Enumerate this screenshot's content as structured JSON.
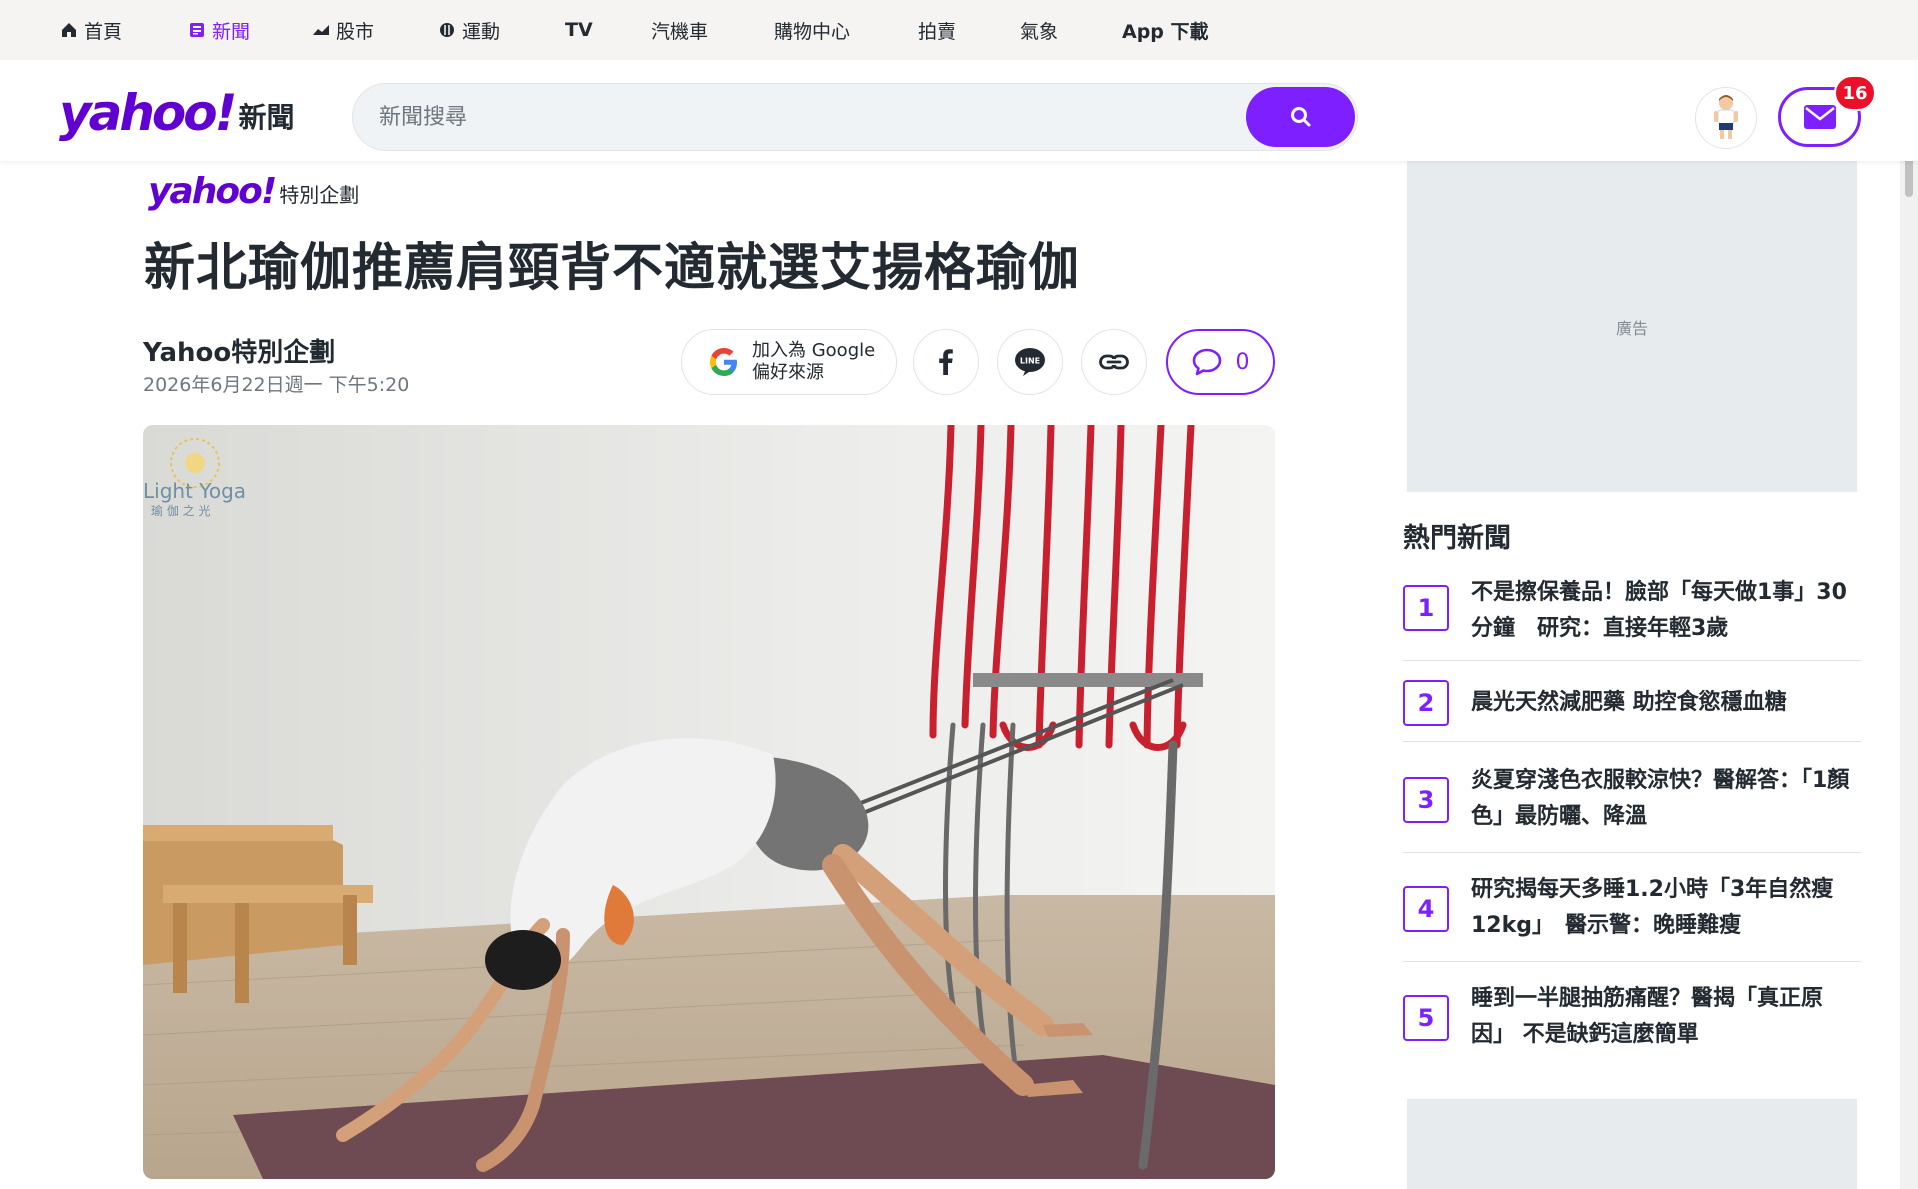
{
  "nav": {
    "items": [
      {
        "label": "首頁",
        "icon": "home-icon"
      },
      {
        "label": "新聞",
        "icon": "news-icon"
      },
      {
        "label": "股市",
        "icon": "chart-icon"
      },
      {
        "label": "運動",
        "icon": "sports-icon"
      },
      {
        "label": "TV"
      },
      {
        "label": "汽機車"
      },
      {
        "label": "購物中心"
      },
      {
        "label": "拍賣"
      },
      {
        "label": "氣象"
      },
      {
        "label": "App 下載"
      }
    ]
  },
  "header": {
    "logo_word": "yahoo!",
    "logo_sub": "新聞",
    "search_placeholder": "新聞搜尋",
    "mail_count": "16"
  },
  "article": {
    "brand_word": "yahoo!",
    "brand_sub": "特別企劃",
    "title": "新北瑜伽推薦肩頸背不適就選艾揚格瑜伽",
    "author": "Yahoo特別企劃",
    "date": "2026年6月22日週一 下午5:20",
    "google_line1": "加入為 Google",
    "google_line2": "偏好來源",
    "comment_count": "0",
    "image_logo_text": "Light Yoga",
    "image_logo_sub": "瑜 伽 之 光"
  },
  "rail": {
    "ad_label": "廣告",
    "trending_title": "熱門新聞",
    "trending": [
      {
        "rank": "1",
        "text": "不是擦保養品！臉部「每天做1事」30分鐘　研究：直接年輕3歲"
      },
      {
        "rank": "2",
        "text": "晨光天然減肥藥 助控食慾穩血糖"
      },
      {
        "rank": "3",
        "text": "炎夏穿淺色衣服較涼快？醫解答：「1顏色」最防曬、降溫"
      },
      {
        "rank": "4",
        "text": "研究揭每天多睡1.2小時「3年自然瘦12kg」　醫示警：晚睡難瘦"
      },
      {
        "rank": "5",
        "text": "睡到一半腿抽筋痛醒？醫揭「真正原因」 不是缺鈣這麼簡單"
      }
    ]
  },
  "colors": {
    "brand": "#6001d2",
    "accent": "#7e1fff",
    "badge": "#eb0f29"
  }
}
